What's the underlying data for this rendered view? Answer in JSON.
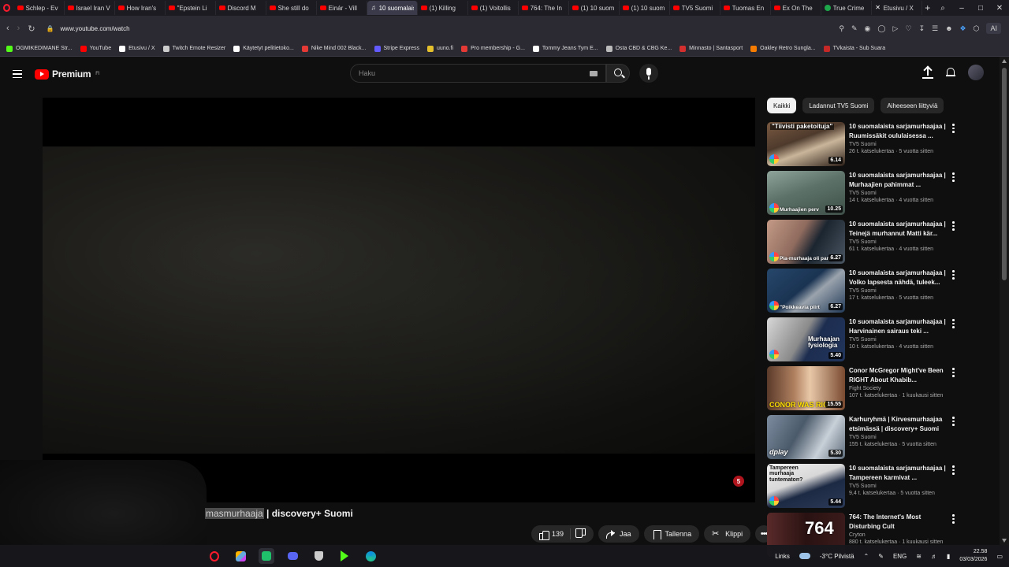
{
  "browser": {
    "tabs": [
      {
        "label": "Schlep - Ev",
        "icon": "youtube-icon"
      },
      {
        "label": "Israel Iran V",
        "icon": "youtube-icon"
      },
      {
        "label": "How Iran's",
        "icon": "youtube-icon"
      },
      {
        "label": "\"Epstein Li",
        "icon": "youtube-icon"
      },
      {
        "label": "Discord M",
        "icon": "youtube-icon"
      },
      {
        "label": "She still do",
        "icon": "youtube-icon"
      },
      {
        "label": "Einár - Vill",
        "icon": "youtube-icon"
      },
      {
        "label": "10 suomalaista",
        "icon": "audio-icon",
        "active": true
      },
      {
        "label": "(1) Killing",
        "icon": "youtube-icon"
      },
      {
        "label": "(1) Voitollis",
        "icon": "youtube-icon"
      },
      {
        "label": "764: The In",
        "icon": "youtube-icon"
      },
      {
        "label": "(1) 10 suom",
        "icon": "youtube-icon"
      },
      {
        "label": "(1) 10 suom",
        "icon": "youtube-icon"
      },
      {
        "label": "TV5 Suomi",
        "icon": "youtube-icon"
      },
      {
        "label": "Tuomas En",
        "icon": "youtube-icon"
      },
      {
        "label": "Ex On The",
        "icon": "youtube-icon"
      },
      {
        "label": "True Crime",
        "icon": "green-icon"
      },
      {
        "label": "Etusivu / X",
        "icon": "x-icon"
      }
    ],
    "url": "www.youtube.com/watch",
    "ai_label": "AI",
    "bookmarks": [
      {
        "label": "OGMIKEDIMANE Str...",
        "color": "#53fc18"
      },
      {
        "label": "YouTube",
        "color": "#ff0000"
      },
      {
        "label": "Etusivu / X",
        "color": "#ffffff"
      },
      {
        "label": "Twitch Emote Resizer",
        "color": "#cccccc"
      },
      {
        "label": "Käytetyt pelitietoko...",
        "color": "#ffffff"
      },
      {
        "label": "Nike Mind 002 Black...",
        "color": "#e53935"
      },
      {
        "label": "Stripe Express",
        "color": "#635bff"
      },
      {
        "label": "uuno.fi",
        "color": "#e5c02d"
      },
      {
        "label": "Pro membership - G...",
        "color": "#e53935"
      },
      {
        "label": "Tommy Jeans Tym E...",
        "color": "#ffffff"
      },
      {
        "label": "Osta CBD & CBG Ke...",
        "color": "#bbbbbb"
      },
      {
        "label": "Minnasto | Santasport",
        "color": "#d32f2f"
      },
      {
        "label": "Oakley Retro Sungla...",
        "color": "#f57c00"
      },
      {
        "label": "TVkaista - Sub Suara",
        "color": "#c62828"
      }
    ]
  },
  "masthead": {
    "logo_text": "Premium",
    "logo_sup": "FI",
    "search_placeholder": "Haku"
  },
  "player": {
    "badge": "5"
  },
  "video": {
    "title_highlight": "masmurhaaja",
    "title_rest": " | discovery+ Suomi"
  },
  "actions": {
    "like_count": "139",
    "share": "Jaa",
    "save": "Tallenna",
    "clip": "Klippi"
  },
  "chips": [
    "Kaikki",
    "Ladannut TV5 Suomi",
    "Aiheeseen liittyviä"
  ],
  "related": [
    {
      "title": "10 suomalaista sarjamurhaajaa | Ruumissäkit oululaisessa ...",
      "channel": "TV5 Suomi",
      "stats": "26 t. katselukertaa · 5 vuotta sitten",
      "duration": "6.14",
      "caption": "\"Tiivisti paketoituja\"",
      "caption_pos": "top",
      "bg": "linear-gradient(160deg,#7a5a42 0%,#4e3a2c 40%,#c9b59a 60%,#2a1d16 100%)",
      "dplay": true
    },
    {
      "title": "10 suomalaista sarjamurhaajaa | Murhaajien pahimmat ...",
      "channel": "TV5 Suomi",
      "stats": "14 t. katselukertaa · 4 vuotta sitten",
      "duration": "10.25",
      "caption": "Murhaajien perv",
      "caption_pos": "bottom",
      "bg": "linear-gradient(160deg,#8fa59b 0%,#5c7268 45%,#3e4f48 100%)",
      "dplay": true
    },
    {
      "title": "10 suomalaista sarjamurhaajaa | Teinejä murhannut Matti kär...",
      "channel": "TV5 Suomi",
      "stats": "61 t. katselukertaa · 4 vuotta sitten",
      "duration": "6.27",
      "caption": "Pia-murhaaja oli parafiili",
      "caption_pos": "bottom",
      "bg": "linear-gradient(120deg,#c49a86 0%,#8f6b5e 40%,#1b2530 60%,#4a5662 100%)",
      "dplay": true
    },
    {
      "title": "10 suomalaista sarjamurhaajaa | Volko lapsesta nähdä, tuleek...",
      "channel": "TV5 Suomi",
      "stats": "17 t. katselukertaa · 5 vuotta sitten",
      "duration": "6.27",
      "caption": "\"Poikkeavia piirt",
      "caption_pos": "bottom",
      "bg": "linear-gradient(140deg,#26476b 0%,#1a3352 45%,#9aa3ad 60%,#223a58 100%)",
      "dplay": true
    },
    {
      "title": "10 suomalaista sarjamurhaajaa | Harvinainen sairaus teki ...",
      "channel": "TV5 Suomi",
      "stats": "10 t. katselukertaa · 4 vuotta sitten",
      "duration": "5.40",
      "caption": "Murhaajan fysiologia",
      "caption_pos": "right",
      "bg": "linear-gradient(120deg,#d8d8d8 0%,#8a8a8a 45%,#1c2d50 60%,#22355c 100%)",
      "dplay": true
    },
    {
      "title": "Conor McGregor Might've Been RIGHT About Khabib...",
      "channel": "Fight Society",
      "stats": "107 t. katselukertaa · 1 kuukausi sitten",
      "duration": "15.55",
      "caption": "CONOR WAS RIG",
      "caption_pos": "bottom-yellow",
      "bg": "linear-gradient(90deg,#5a3a2a 0%,#b08060 35%,#e8c8a8 55%,#7a4a30 100%)",
      "dplay": false
    },
    {
      "title": "Karhuryhmä | Kirvesmurhaajaa etsimässä | discovery+ Suomi",
      "channel": "TV5 Suomi",
      "stats": "155 t. katselukertaa · 5 vuotta sitten",
      "duration": "5.30",
      "caption": "dplay",
      "caption_pos": "bottom-left",
      "bg": "linear-gradient(120deg,#7d8da0 0%,#4b5a6a 40%,#c8d0d8 70%,#5d6b7a 100%)",
      "dplay": false
    },
    {
      "title": "10 suomalaista sarjamurhaajaa | Tampereen karmivat ...",
      "channel": "TV5 Suomi",
      "stats": "9,4 t. katselukertaa · 5 vuotta sitten",
      "duration": "5.44",
      "caption": "Tampereen murhaaja tuntematon?",
      "caption_pos": "top-dark",
      "bg": "linear-gradient(160deg,#f0f0f0 0%,#d8d8d8 40%,#1d2a44 60%,#2b3a58 100%)",
      "dplay": true
    },
    {
      "title": "764: The Internet's Most Disturbing Cult",
      "channel": "Cryton",
      "stats": "880 t. katselukertaa · 1 kuukausi sitten",
      "duration": "",
      "caption": "764",
      "caption_pos": "big",
      "bg": "linear-gradient(90deg,#5a2a2a 0%,#2a1212 50%,#3a1a1a 100%)",
      "dplay": false
    }
  ],
  "taskbar": {
    "links": "Links",
    "weather": "-3°C  Pilvistä",
    "lang": "ENG",
    "time": "22.58",
    "date": "03/03/2026"
  }
}
